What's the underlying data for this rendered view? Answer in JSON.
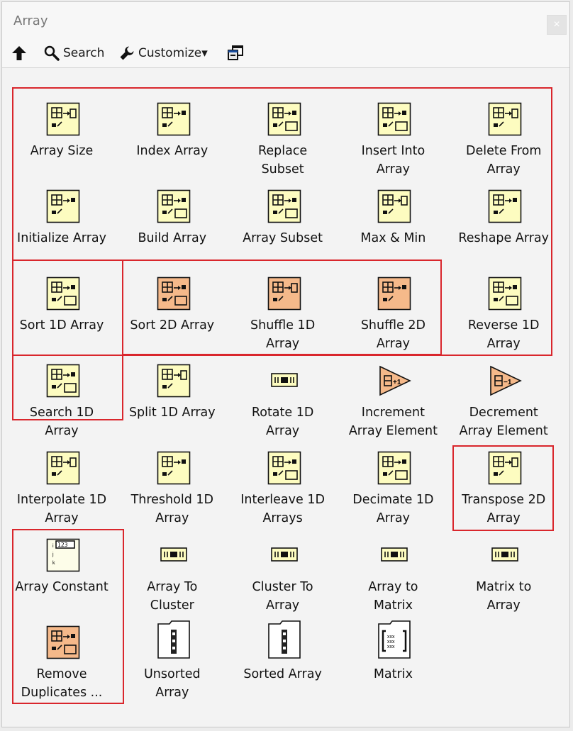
{
  "window": {
    "title": "Array",
    "close_label": "×"
  },
  "toolbar": {
    "search_label": "Search",
    "customize_label": "Customize▾"
  },
  "items": [
    {
      "label": "Array Size",
      "kind": "yellow"
    },
    {
      "label": "Index Array",
      "kind": "yellow"
    },
    {
      "label": "Replace\nSubset",
      "kind": "yellow"
    },
    {
      "label": "Insert Into\nArray",
      "kind": "yellow"
    },
    {
      "label": "Delete From\nArray",
      "kind": "yellow"
    },
    {
      "label": "Initialize Array",
      "kind": "yellow"
    },
    {
      "label": "Build Array",
      "kind": "yellow"
    },
    {
      "label": "Array Subset",
      "kind": "yellow"
    },
    {
      "label": "Max & Min",
      "kind": "yellow"
    },
    {
      "label": "Reshape Array",
      "kind": "yellow"
    },
    {
      "label": "Sort 1D Array",
      "kind": "yellow"
    },
    {
      "label": "Sort 2D Array",
      "kind": "orange"
    },
    {
      "label": "Shuffle 1D\nArray",
      "kind": "orange"
    },
    {
      "label": "Shuffle 2D\nArray",
      "kind": "orange"
    },
    {
      "label": "Reverse 1D\nArray",
      "kind": "yellow"
    },
    {
      "label": "Search 1D\nArray",
      "kind": "yellow"
    },
    {
      "label": "Split 1D Array",
      "kind": "yellow"
    },
    {
      "label": "Rotate 1D\nArray",
      "kind": "flat"
    },
    {
      "label": "Increment\nArray Element",
      "kind": "triangle"
    },
    {
      "label": "Decrement\nArray Element",
      "kind": "triangle"
    },
    {
      "label": "Interpolate 1D\nArray",
      "kind": "yellow"
    },
    {
      "label": "Threshold 1D\nArray",
      "kind": "yellow"
    },
    {
      "label": "Interleave 1D\nArrays",
      "kind": "yellow"
    },
    {
      "label": "Decimate 1D\nArray",
      "kind": "yellow"
    },
    {
      "label": "Transpose 2D\nArray",
      "kind": "yellow"
    },
    {
      "label": "Array Constant",
      "kind": "const"
    },
    {
      "label": "Array To\nCluster",
      "kind": "flat"
    },
    {
      "label": "Cluster To\nArray",
      "kind": "flat"
    },
    {
      "label": "Array to\nMatrix",
      "kind": "flat"
    },
    {
      "label": "Matrix to\nArray",
      "kind": "flat"
    },
    {
      "label": "Remove\nDuplicates ...",
      "kind": "orange"
    },
    {
      "label": "Unsorted\nArray",
      "kind": "folder"
    },
    {
      "label": "Sorted Array",
      "kind": "folder"
    },
    {
      "label": "Matrix",
      "kind": "matrix"
    }
  ]
}
